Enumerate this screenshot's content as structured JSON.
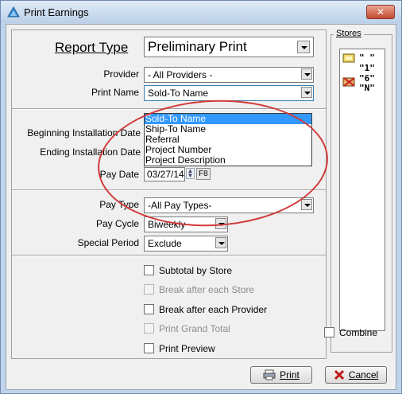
{
  "window": {
    "title": "Print Earnings",
    "close_label": "✕"
  },
  "form": {
    "report_type_label": "Report Type",
    "report_type_value": "Preliminary Print",
    "provider_label": "Provider",
    "provider_value": "- All Providers -",
    "print_name_label": "Print Name",
    "print_name_value": "Sold-To Name",
    "print_name_options": [
      "Sold-To Name",
      "Ship-To Name",
      "Referral",
      "Project Number",
      "Project Description"
    ],
    "begin_install_label": "Beginning Installation Date",
    "end_install_label": "Ending Installation Date",
    "pay_date_label": "Pay Date",
    "pay_date_value": "03/27/14",
    "f8_label": "F8",
    "pay_type_label": "Pay Type",
    "pay_type_value": "-All Pay Types-",
    "pay_cycle_label": "Pay Cycle",
    "pay_cycle_value": "Biweekly",
    "special_period_label": "Special Period",
    "special_period_value": "Exclude"
  },
  "options": {
    "subtotal_by_store": "Subtotal by Store",
    "break_after_store": "Break after each Store",
    "break_after_provider": "Break after each Provider",
    "print_grand_total": "Print Grand Total",
    "print_preview": "Print Preview"
  },
  "stores": {
    "title": "Stores",
    "items": [
      "\" \"",
      "\"1\"",
      "\"6\"",
      "\"N\""
    ],
    "combine_label": "Combine"
  },
  "buttons": {
    "print": "Print",
    "cancel": "Cancel"
  },
  "colors": {
    "selection": "#3399ff",
    "highlight_ellipse": "#d13a3a",
    "title_bar": "#bcd0e8"
  }
}
